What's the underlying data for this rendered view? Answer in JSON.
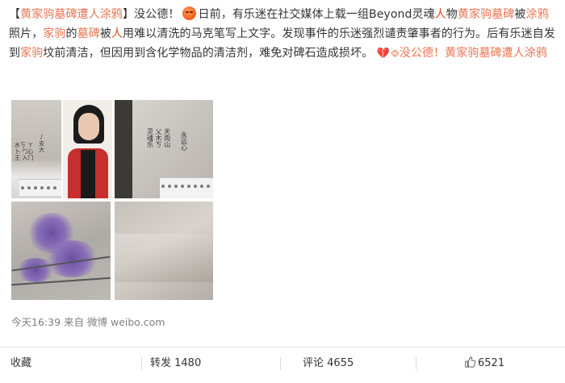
{
  "post": {
    "segments": [
      {
        "text": "【",
        "style": "plain"
      },
      {
        "text": "黄家驹墓碑遭人涂鸦",
        "style": "link"
      },
      {
        "text": "】没公德！",
        "style": "plain"
      },
      {
        "text": "",
        "style": "emoji"
      },
      {
        "text": "日前，有乐迷在社交媒体上载一组Beyond灵魂",
        "style": "plain"
      },
      {
        "text": "人",
        "style": "red"
      },
      {
        "text": "物",
        "style": "plain"
      },
      {
        "text": "黄家驹墓碑",
        "style": "link"
      },
      {
        "text": "被",
        "style": "plain"
      },
      {
        "text": "涂鸦",
        "style": "link"
      },
      {
        "text": "照片，",
        "style": "plain"
      },
      {
        "text": "家驹",
        "style": "link"
      },
      {
        "text": "的",
        "style": "plain"
      },
      {
        "text": "墓碑",
        "style": "link"
      },
      {
        "text": "被",
        "style": "plain"
      },
      {
        "text": "人",
        "style": "red"
      },
      {
        "text": "用难以清洗的马克笔写上文字。发现事件的乐迷强烈谴责肇事者的行为。后有乐迷自发到",
        "style": "plain"
      },
      {
        "text": "家驹",
        "style": "link"
      },
      {
        "text": "坟前清洁，但因用到含化学物品的清洁剂，难免对碑石造成损坏。",
        "style": "plain"
      }
    ],
    "link_card": {
      "heart_icon": "broken-heart-icon",
      "link_icon": "link-icon",
      "label": "没公德！黄家驹墓碑遭人涂鸦"
    },
    "photos": [
      {
        "alt": "photo-1"
      },
      {
        "alt": "photo-2"
      },
      {
        "alt": "photo-3"
      },
      {
        "alt": "photo-4"
      },
      {
        "alt": "photo-5"
      }
    ],
    "meta": {
      "time": "今天16:39",
      "from_label": "来自",
      "source": "微博 weibo.com"
    }
  },
  "actions": {
    "favorite": "收藏",
    "repost": "转发 1480",
    "comment": "评论 4655",
    "like_icon": "thumbs-up-icon",
    "like_count": "6521"
  },
  "colors": {
    "link": "#eb7350",
    "highlight": "#e3491f",
    "meta": "#808080"
  }
}
